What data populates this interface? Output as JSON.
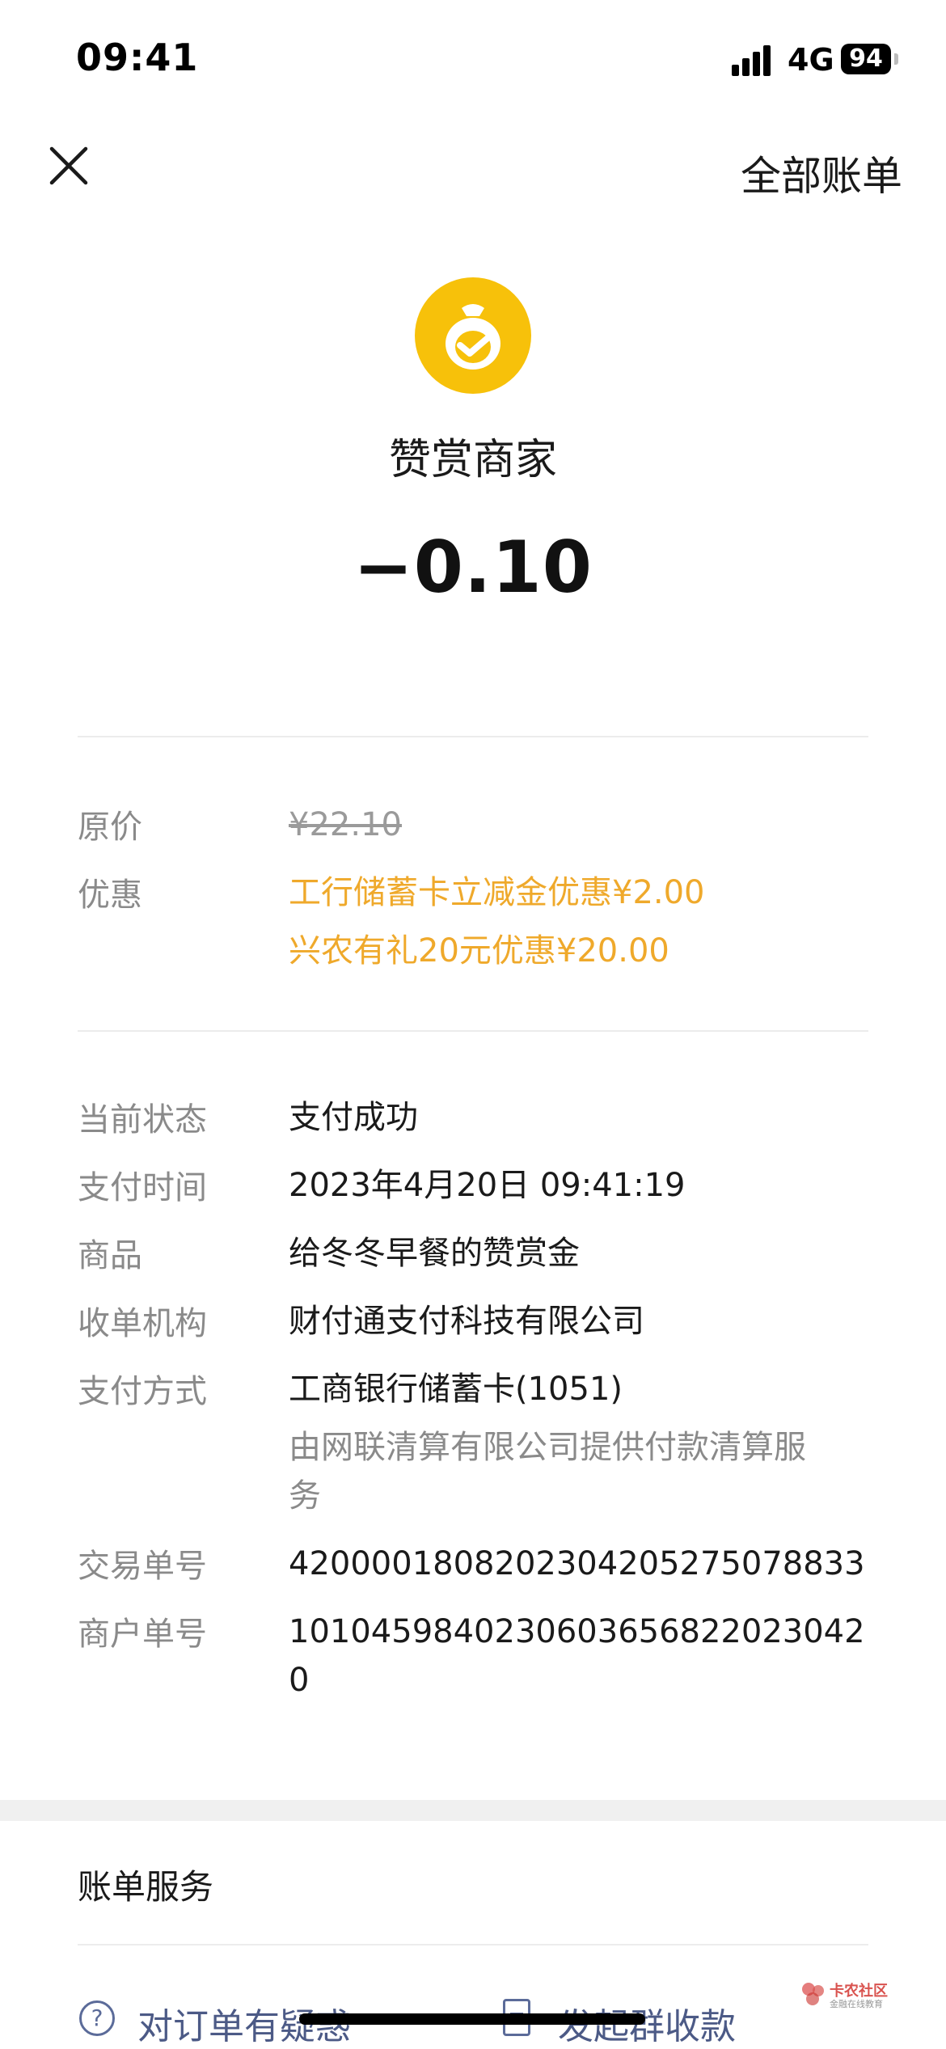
{
  "status_bar": {
    "time": "09:41",
    "network": "4G",
    "battery": "94"
  },
  "nav": {
    "all_bills": "全部账单"
  },
  "header": {
    "merchant": "赞赏商家",
    "amount": "−0.10"
  },
  "price": {
    "original_label": "原价",
    "original_value": "¥22.10",
    "discount_label": "优惠",
    "discounts": [
      "工行储蓄卡立减金优惠¥2.00",
      "兴农有礼20元优惠¥20.00"
    ]
  },
  "details": {
    "status_label": "当前状态",
    "status_value": "支付成功",
    "time_label": "支付时间",
    "time_value": "2023年4月20日 09:41:19",
    "product_label": "商品",
    "product_value": "给冬冬早餐的赞赏金",
    "acquirer_label": "收单机构",
    "acquirer_value": "财付通支付科技有限公司",
    "method_label": "支付方式",
    "method_value": "工商银行储蓄卡(1051)",
    "method_note_1": "由网联清算有限公司提供付款清算服",
    "method_note_2": "务",
    "txn_label": "交易单号",
    "txn_value": "4200001808202304205275078833",
    "merchant_no_label": "商户单号",
    "merchant_no_line1": "1010459840230603656822023042",
    "merchant_no_line2": "0"
  },
  "services": {
    "title": "账单服务",
    "question": "对订单有疑惑",
    "group_pay": "发起群收款"
  },
  "watermark": {
    "text": "卡农社区",
    "sub": "金融在线教育"
  },
  "colors": {
    "accent_orange": "#efa92b",
    "logo_yellow": "#f7c10a",
    "link_blue": "#4c5a86"
  }
}
